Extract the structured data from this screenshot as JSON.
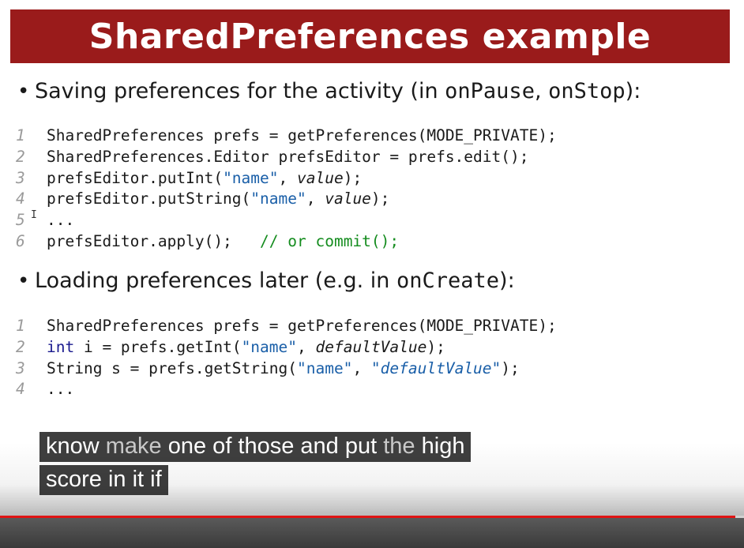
{
  "slide": {
    "title": "SharedPreferences example",
    "bullet1": {
      "prefix": "Saving preferences for the activity (in ",
      "m1": "onPause",
      "sep": ", ",
      "m2": "onStop",
      "suffix": "):"
    },
    "code1": [
      {
        "n": "1",
        "segs": [
          {
            "t": "SharedPreferences prefs = getPreferences(MODE_PRIVATE);",
            "c": ""
          }
        ]
      },
      {
        "n": "2",
        "segs": [
          {
            "t": "SharedPreferences.Editor prefsEditor = prefs.edit();",
            "c": ""
          }
        ]
      },
      {
        "n": "3",
        "segs": [
          {
            "t": "prefsEditor.putInt(",
            "c": ""
          },
          {
            "t": "\"name\"",
            "c": "str"
          },
          {
            "t": ", ",
            "c": ""
          },
          {
            "t": "value",
            "c": "var"
          },
          {
            "t": ");",
            "c": ""
          }
        ]
      },
      {
        "n": "4",
        "segs": [
          {
            "t": "prefsEditor.putString(",
            "c": ""
          },
          {
            "t": "\"name\"",
            "c": "str"
          },
          {
            "t": ", ",
            "c": ""
          },
          {
            "t": "value",
            "c": "var"
          },
          {
            "t": ");",
            "c": ""
          }
        ]
      },
      {
        "n": "5",
        "segs": [
          {
            "t": "...",
            "c": ""
          }
        ]
      },
      {
        "n": "6",
        "segs": [
          {
            "t": "prefsEditor.apply();   ",
            "c": ""
          },
          {
            "t": "// or commit();",
            "c": "cmt"
          }
        ]
      }
    ],
    "bullet2": {
      "prefix": "Loading preferences later (e.g. in ",
      "m1": "onCreate",
      "suffix": "):"
    },
    "code2": [
      {
        "n": "1",
        "segs": [
          {
            "t": "SharedPreferences prefs = getPreferences(MODE_PRIVATE);",
            "c": ""
          }
        ]
      },
      {
        "n": "2",
        "segs": [
          {
            "t": "int",
            "c": "kw"
          },
          {
            "t": " i = prefs.getInt(",
            "c": ""
          },
          {
            "t": "\"name\"",
            "c": "str"
          },
          {
            "t": ", ",
            "c": ""
          },
          {
            "t": "defaultValue",
            "c": "var"
          },
          {
            "t": ");",
            "c": ""
          }
        ]
      },
      {
        "n": "3",
        "segs": [
          {
            "t": "String s = prefs.getString(",
            "c": ""
          },
          {
            "t": "\"name\"",
            "c": "str"
          },
          {
            "t": ", ",
            "c": ""
          },
          {
            "t": "\"defaultValue\"",
            "c": "str var"
          },
          {
            "t": ");",
            "c": ""
          }
        ]
      },
      {
        "n": "4",
        "segs": [
          {
            "t": "...",
            "c": ""
          }
        ]
      }
    ]
  },
  "captions": {
    "line1": {
      "a": "know ",
      "b": "make",
      "c": " one of those and put ",
      "d": "the",
      "e": " high"
    },
    "line2": "score in it if"
  },
  "player": {
    "progress": 0.988,
    "progress_color": "#e01515"
  },
  "colors": {
    "title_bg": "#9a1b1b",
    "string": "#1a5fa8",
    "comment": "#148c1e",
    "keyword": "#1a1a8e"
  }
}
